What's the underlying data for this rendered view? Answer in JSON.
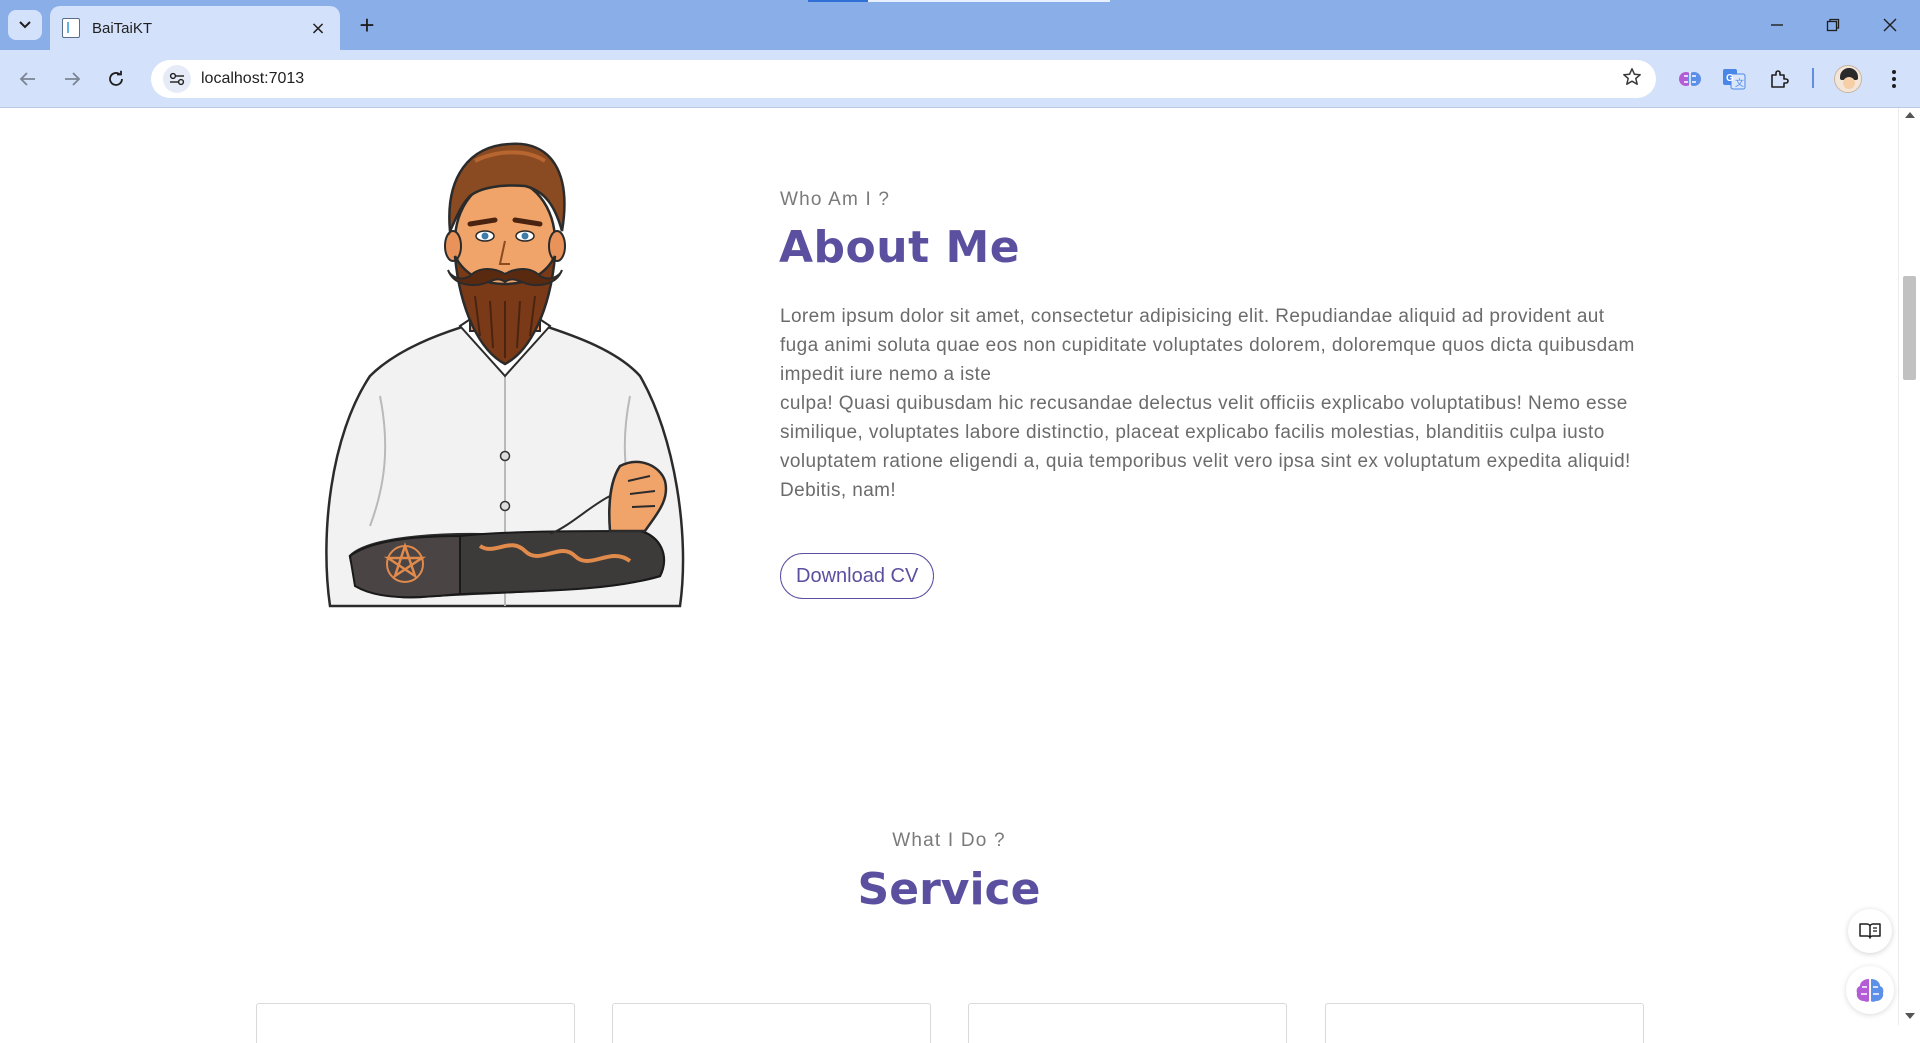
{
  "browser": {
    "tab_title": "BaiTaiKT",
    "url": "localhost:7013",
    "new_tab_glyph": "+",
    "tab_close_glyph": "×",
    "minimize_glyph": "—",
    "restore_glyph": "❐",
    "close_glyph": "✕",
    "back_glyph": "←",
    "forward_glyph": "→",
    "reload_glyph": "↻",
    "star_glyph": "☆"
  },
  "about": {
    "subtitle": "Who Am I ?",
    "title": "About Me",
    "paragraph_1": "Lorem ipsum dolor sit amet, consectetur adipisicing elit. Repudiandae aliquid ad provident aut fuga animi soluta quae eos non cupiditate voluptates dolorem, doloremque quos dicta quibusdam impedit iure nemo a iste",
    "paragraph_2": "culpa! Quasi quibusdam hic recusandae delectus velit officiis explicabo voluptatibus! Nemo esse similique, voluptates labore distinctio, placeat explicabo facilis molestias, blanditiis culpa iusto voluptatem ratione eligendi a, quia temporibus velit vero ipsa sint ex voluptatum expedita aliquid! Debitis, nam!",
    "button_label": "Download CV"
  },
  "service": {
    "subtitle": "What I Do ?",
    "title": "Service"
  },
  "colors": {
    "accent": "#5b4f9f",
    "tabbar": "#8aaee8",
    "toolbar": "#d4e1fa",
    "muted_text": "#6b6b6b"
  },
  "icons": {
    "portrait": "bearded-man-illustration-icon",
    "reader": "reading-mode-icon",
    "assistant": "brain-assistant-icon"
  }
}
